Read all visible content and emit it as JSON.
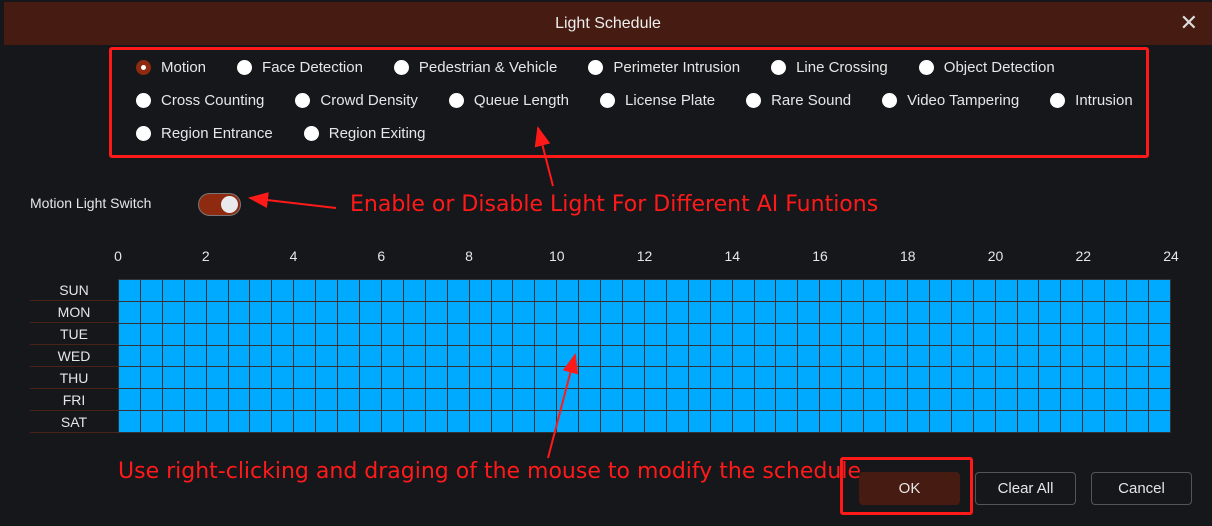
{
  "dialog": {
    "title": "Light Schedule",
    "close_icon": "close-icon"
  },
  "ai_functions": {
    "selected": "Motion",
    "rows": [
      [
        "Motion",
        "Face Detection",
        "Pedestrian & Vehicle",
        "Perimeter Intrusion",
        "Line Crossing",
        "Object Detection"
      ],
      [
        "Cross Counting",
        "Crowd Density",
        "Queue Length",
        "License Plate",
        "Rare Sound",
        "Video Tampering",
        "Intrusion"
      ],
      [
        "Region Entrance",
        "Region Exiting"
      ]
    ]
  },
  "switch": {
    "label": "Motion Light Switch",
    "on": true
  },
  "schedule": {
    "hours": [
      "0",
      "2",
      "4",
      "6",
      "8",
      "10",
      "12",
      "14",
      "16",
      "18",
      "20",
      "22",
      "24"
    ],
    "days": [
      "SUN",
      "MON",
      "TUE",
      "WED",
      "THU",
      "FRI",
      "SAT"
    ],
    "slots_per_day": 48,
    "all_selected": true,
    "fill_color": "#00aaff"
  },
  "buttons": {
    "ok": "OK",
    "clear_all": "Clear All",
    "cancel": "Cancel"
  },
  "annotations": {
    "switch_note": "Enable or Disable Light For Different AI Funtions",
    "schedule_note": "Use right-clicking and draging of the mouse to modify the schedule.",
    "color": "#ff1a1a"
  }
}
